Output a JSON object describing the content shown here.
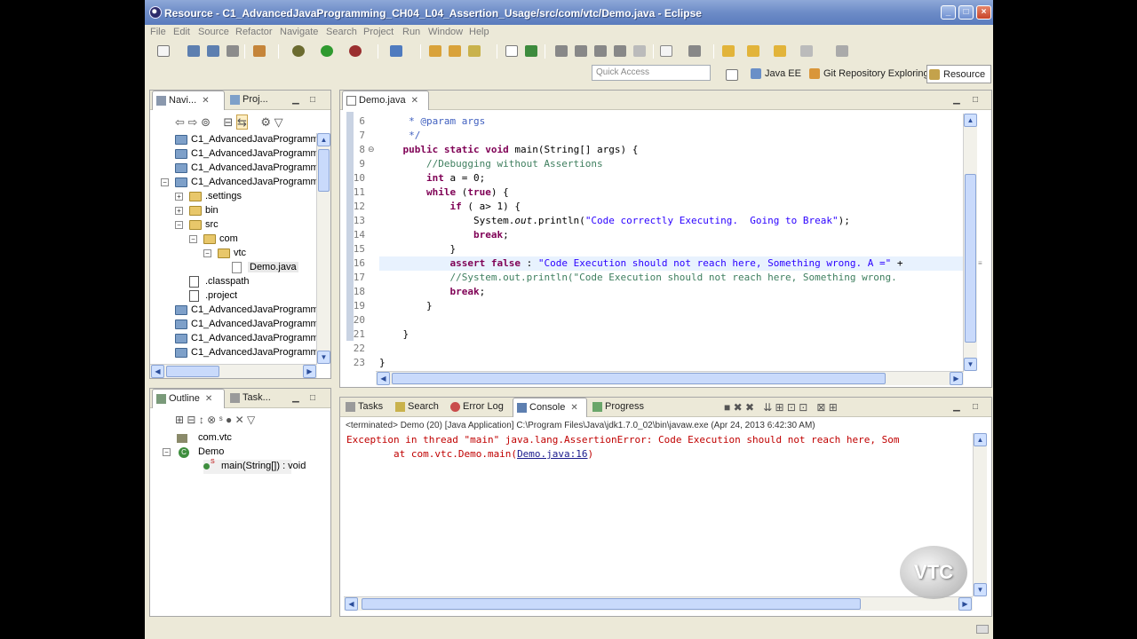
{
  "window": {
    "title": "Resource - C1_AdvancedJavaProgramming_CH04_L04_Assertion_Usage/src/com/vtc/Demo.java - Eclipse",
    "minimize": "_",
    "maximize": "□",
    "close": "×"
  },
  "menu": [
    "File",
    "Edit",
    "Source",
    "Refactor",
    "Navigate",
    "Search",
    "Project",
    "Run",
    "Window",
    "Help"
  ],
  "quick_access": {
    "placeholder": "Quick Access"
  },
  "perspectives": [
    "Java EE",
    "Git Repository Exploring",
    "Resource"
  ],
  "navigator": {
    "tabs": [
      "Navi...",
      "Proj..."
    ],
    "items": [
      {
        "label": "C1_AdvancedJavaProgrammir",
        "type": "project",
        "indent": 0
      },
      {
        "label": "C1_AdvancedJavaProgrammir",
        "type": "project",
        "indent": 0
      },
      {
        "label": "C1_AdvancedJavaProgrammir",
        "type": "project",
        "indent": 0
      },
      {
        "label": "C1_AdvancedJavaProgrammir",
        "type": "project-open",
        "indent": 0
      },
      {
        "label": ".settings",
        "type": "folder",
        "indent": 1
      },
      {
        "label": "bin",
        "type": "folder",
        "indent": 1
      },
      {
        "label": "src",
        "type": "folder-open",
        "indent": 1
      },
      {
        "label": "com",
        "type": "folder-open",
        "indent": 2
      },
      {
        "label": "vtc",
        "type": "folder-open",
        "indent": 3
      },
      {
        "label": "Demo.java",
        "type": "file",
        "indent": 4
      },
      {
        "label": ".classpath",
        "type": "xfile",
        "indent": 1
      },
      {
        "label": ".project",
        "type": "xfile",
        "indent": 1
      },
      {
        "label": "C1_AdvancedJavaProgrammir",
        "type": "project",
        "indent": 0
      },
      {
        "label": "C1_AdvancedJavaProgrammir",
        "type": "project",
        "indent": 0
      },
      {
        "label": "C1_AdvancedJavaProgrammir",
        "type": "project",
        "indent": 0
      },
      {
        "label": "C1_AdvancedJavaProgrammir",
        "type": "project",
        "indent": 0
      }
    ]
  },
  "outline": {
    "tabs": [
      "Outline",
      "Task..."
    ],
    "items": [
      "com.vtc",
      "Demo",
      "main(String[]) : void"
    ]
  },
  "editor": {
    "tab": "Demo.java",
    "lines": [
      {
        "n": "6",
        "html": "     <span class='jd'>* @param args</span>"
      },
      {
        "n": "7",
        "html": "     <span class='jd'>*/</span>"
      },
      {
        "n": "8",
        "html": "    <span class='kw'>public static void</span> main(String[] args) {"
      },
      {
        "n": "9",
        "html": "        <span class='cm'>//Debugging without Assertions</span>"
      },
      {
        "n": "10",
        "html": "        <span class='kw'>int</span> a = 0;"
      },
      {
        "n": "11",
        "html": "        <span class='kw'>while</span> (<span class='kw'>true</span>) {"
      },
      {
        "n": "12",
        "html": "            <span class='kw'>if</span> ( a> 1) {"
      },
      {
        "n": "13",
        "html": "                System.<i>out</i>.println(<span class='st'>\"Code correctly Executing.  Going to Break\"</span>);"
      },
      {
        "n": "14",
        "html": "                <span class='kw'>break</span>;"
      },
      {
        "n": "15",
        "html": "            }"
      },
      {
        "n": "16",
        "html": "            <span class='kw'>assert false</span> : <span class='st'>\"Code Execution should not reach here, Something wrong. A =\"</span> +"
      },
      {
        "n": "17",
        "html": "            <span class='cm'>//System.out.println(\"Code Execution should not reach here, Something wrong.</span>"
      },
      {
        "n": "18",
        "html": "            <span class='kw'>break</span>;"
      },
      {
        "n": "19",
        "html": "        }"
      },
      {
        "n": "20",
        "html": ""
      },
      {
        "n": "21",
        "html": "    }"
      },
      {
        "n": "22",
        "html": ""
      },
      {
        "n": "23",
        "html": "}"
      }
    ]
  },
  "bottom_panel": {
    "tabs": [
      "Tasks",
      "Search",
      "Error Log",
      "Console",
      "Progress"
    ],
    "terminated": "<terminated> Demo (20) [Java Application] C:\\Program Files\\Java\\jdk1.7.0_02\\bin\\javaw.exe (Apr 24, 2013 6:42:30 AM)",
    "line1": "Exception in thread \"main\" java.lang.AssertionError: Code Execution should not reach here, Som",
    "line2_prefix": "        at com.vtc.Demo.main(",
    "line2_link": "Demo.java:16",
    "line2_suffix": ")"
  },
  "watermark": "VTC",
  "colors": {
    "keyword": "#7f0055",
    "comment": "#3f7f5f",
    "string": "#2a00ff",
    "error": "#c00000"
  }
}
